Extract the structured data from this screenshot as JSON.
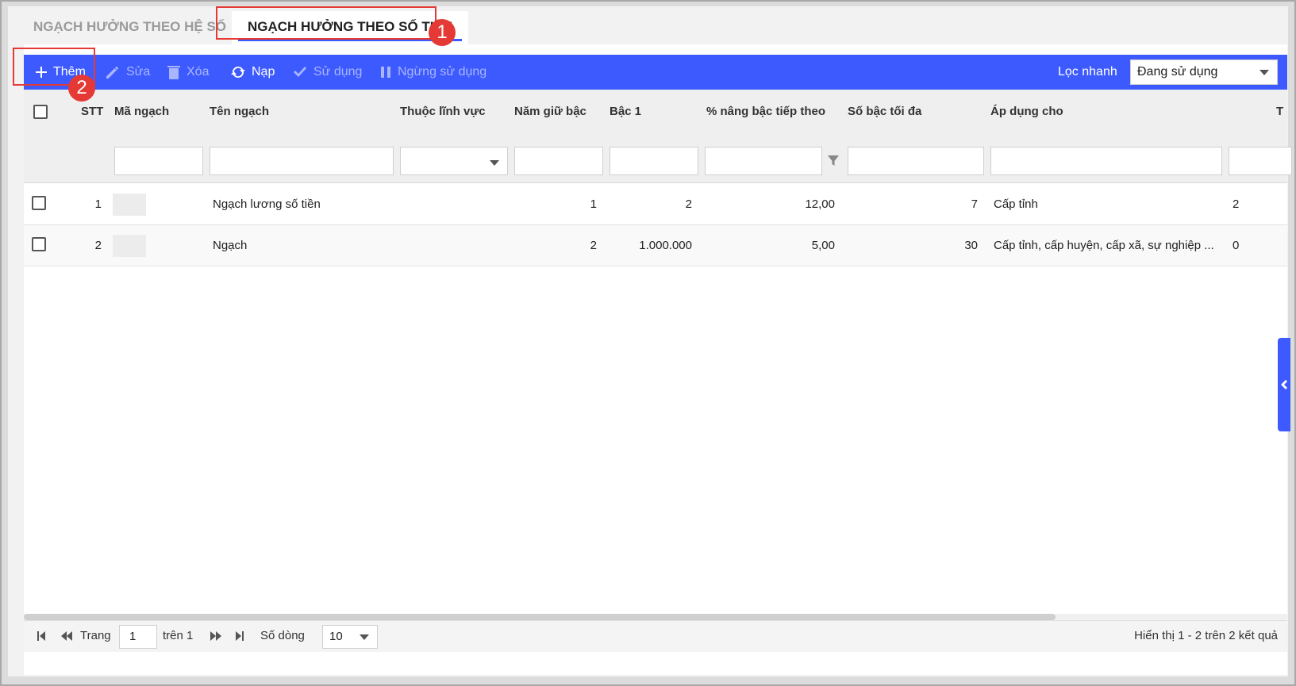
{
  "tabs": [
    {
      "label": "NGẠCH HƯỞNG THEO HỆ SỐ",
      "active": false
    },
    {
      "label": "NGẠCH HƯỞNG THEO SỐ TIỀN",
      "active": true
    }
  ],
  "callouts": [
    "1",
    "2"
  ],
  "toolbar": {
    "add": "Thêm",
    "edit": "Sửa",
    "delete": "Xóa",
    "reload": "Nạp",
    "use": "Sử dụng",
    "stop": "Ngừng sử dụng",
    "quick_filter_label": "Lọc nhanh",
    "quick_filter_value": "Đang sử dụng"
  },
  "columns": {
    "stt": "STT",
    "code": "Mã ngạch",
    "name": "Tên ngạch",
    "field": "Thuộc lĩnh vực",
    "years": "Năm giữ bậc",
    "level1": "Bậc 1",
    "percent": "% nâng bậc tiếp theo",
    "max_level": "Số bậc tối đa",
    "apply": "Áp dụng cho",
    "more": "T"
  },
  "rows": [
    {
      "stt": "1",
      "name": "Ngạch lương số tiền",
      "years": "1",
      "level1": "2",
      "percent": "12,00",
      "max_level": "7",
      "apply": "Cấp tỉnh",
      "more": "2"
    },
    {
      "stt": "2",
      "name": "Ngạch",
      "years": "2",
      "level1": "1.000.000",
      "percent": "5,00",
      "max_level": "30",
      "apply": "Cấp tỉnh, cấp huyện, cấp xã, sự nghiệp ...",
      "more": "0"
    }
  ],
  "pager": {
    "page_label": "Trang",
    "page_value": "1",
    "of_label": "trên 1",
    "rows_label": "Số dòng",
    "rows_value": "10",
    "summary": "Hiển thị 1 - 2 trên 2 kết quả"
  },
  "colors": {
    "accent": "#3d5afe",
    "callout": "#e53935"
  }
}
